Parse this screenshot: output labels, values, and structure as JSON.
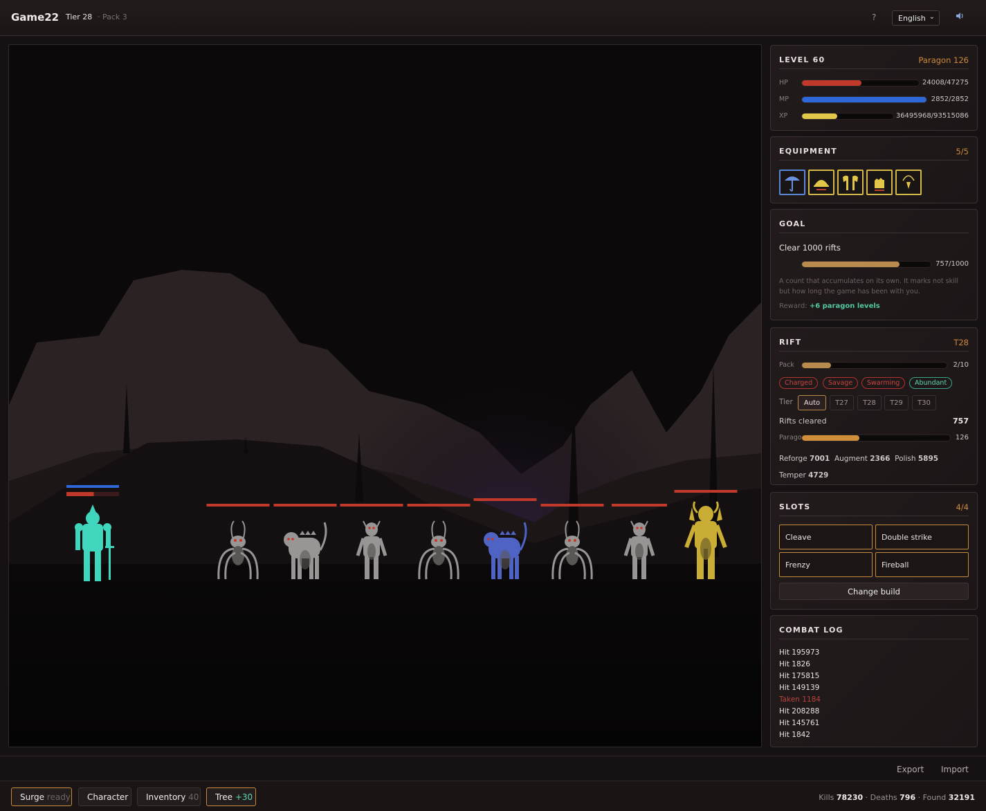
{
  "header": {
    "brand": "Game22",
    "tier": "Tier 28",
    "pack": "· Pack 3",
    "help": "?",
    "language": "English",
    "language_options": [
      "English"
    ],
    "sound_icon": "speaker-icon"
  },
  "scene": {
    "player": {
      "hp_fraction": 0.52,
      "mp_fraction": 1.0,
      "color": "#3fd6bd"
    },
    "enemies": [
      {
        "kind": "spider",
        "color": "#9a9595",
        "hp_fraction": 1.0
      },
      {
        "kind": "hound",
        "color": "#9a9595",
        "hp_fraction": 1.0
      },
      {
        "kind": "imp",
        "color": "#9a9595",
        "hp_fraction": 1.0
      },
      {
        "kind": "spider",
        "color": "#9a9595",
        "hp_fraction": 1.0
      },
      {
        "kind": "hound",
        "color": "#4f63c4",
        "hp_fraction": 1.0
      },
      {
        "kind": "spider",
        "color": "#9a9595",
        "hp_fraction": 1.0
      },
      {
        "kind": "imp",
        "color": "#9a9595",
        "hp_fraction": 1.0
      },
      {
        "kind": "boss",
        "color": "#c9ad35",
        "hp_fraction": 1.0
      }
    ],
    "hp_bar_color": "#c0392b",
    "mp_bar_color": "#2e68d8"
  },
  "level": {
    "title": "LEVEL 60",
    "paragon": "Paragon 126",
    "bars": [
      {
        "label": "HP",
        "value": "24008/47275",
        "fraction": 0.508,
        "color": "#c0392b"
      },
      {
        "label": "MP",
        "value": "2852/2852",
        "fraction": 1.0,
        "color": "#2e68d8"
      },
      {
        "label": "XP",
        "value": "36495968/93515086",
        "fraction": 0.39,
        "color": "#e3c74a"
      }
    ]
  },
  "equipment": {
    "title": "EQUIPMENT",
    "count": "5/5",
    "slots": [
      "weapon-icon",
      "helm-icon",
      "armor-icon",
      "gloves-icon",
      "amulet-icon"
    ]
  },
  "goal": {
    "title": "GOAL",
    "name": "Clear 1000 rifts",
    "value": "757/1000",
    "fraction": 0.757,
    "description": "A count that accumulates on its own. It marks not skill but how long the game has been with you.",
    "reward_label": "Reward:",
    "reward_value": "+6 paragon levels"
  },
  "rift": {
    "title": "RIFT",
    "tier": "T28",
    "pack_label": "Pack",
    "pack_value": "2/10",
    "pack_fraction": 0.2,
    "affixes": [
      {
        "label": "Charged",
        "good": false
      },
      {
        "label": "Savage",
        "good": false
      },
      {
        "label": "Swarming",
        "good": false
      },
      {
        "label": "Abundant",
        "good": true
      }
    ],
    "tier_label": "Tier",
    "tier_options": [
      "Auto",
      "T27",
      "T28",
      "T29",
      "T30"
    ],
    "tier_selected": "Auto",
    "rifts_cleared_label": "Rifts cleared",
    "rifts_cleared_value": "757",
    "paragon_label": "Paragon",
    "paragon_value": "126",
    "paragon_fraction": 0.39,
    "reforge_label": "Reforge",
    "reforge_value": "7001",
    "augment_label": "Augment",
    "augment_value": "2366",
    "polish_label": "Polish",
    "polish_value": "5895",
    "temper_label": "Temper",
    "temper_value": "4729"
  },
  "slots": {
    "title": "SLOTS",
    "count": "4/4",
    "skills": [
      "Cleave",
      "Double strike",
      "Frenzy",
      "Fireball"
    ],
    "change_build": "Change build"
  },
  "combat_log": {
    "title": "COMBAT LOG",
    "lines": [
      {
        "text": "Hit 195973",
        "taken": false
      },
      {
        "text": "Hit 1826",
        "taken": false
      },
      {
        "text": "Hit 175815",
        "taken": false
      },
      {
        "text": "Hit 149139",
        "taken": false
      },
      {
        "text": "Taken 1184",
        "taken": true
      },
      {
        "text": "Hit 208288",
        "taken": false
      },
      {
        "text": "Hit 145761",
        "taken": false
      },
      {
        "text": "Hit 1842",
        "taken": false
      }
    ]
  },
  "footer": {
    "export": "Export",
    "import": "Import",
    "surge": "Surge",
    "surge_state": "ready",
    "character": "Character",
    "inventory": "Inventory",
    "inventory_count": "40",
    "tree": "Tree",
    "tree_points": "+30",
    "kills_label": "Kills",
    "kills": "78230",
    "deaths_label": "Deaths",
    "deaths": "796",
    "found_label": "Found",
    "found": "32191"
  }
}
